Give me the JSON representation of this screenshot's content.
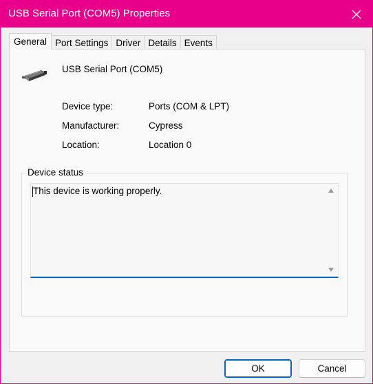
{
  "window": {
    "title": "USB Serial Port (COM5) Properties",
    "title_bar_color": "#e8008a"
  },
  "tabs": [
    {
      "label": "General",
      "active": true
    },
    {
      "label": "Port Settings",
      "active": false
    },
    {
      "label": "Driver",
      "active": false
    },
    {
      "label": "Details",
      "active": false
    },
    {
      "label": "Events",
      "active": false
    }
  ],
  "general": {
    "device_name": "USB Serial Port (COM5)",
    "device_icon": "serial-port-connector-icon",
    "properties": [
      {
        "label": "Device type:",
        "value": "Ports (COM & LPT)"
      },
      {
        "label": "Manufacturer:",
        "value": "Cypress"
      },
      {
        "label": "Location:",
        "value": "Location 0"
      }
    ],
    "status_group_label": "Device status",
    "status_text": "This device is working properly."
  },
  "buttons": {
    "ok": "OK",
    "cancel": "Cancel"
  },
  "accent_color": "#0067c0"
}
